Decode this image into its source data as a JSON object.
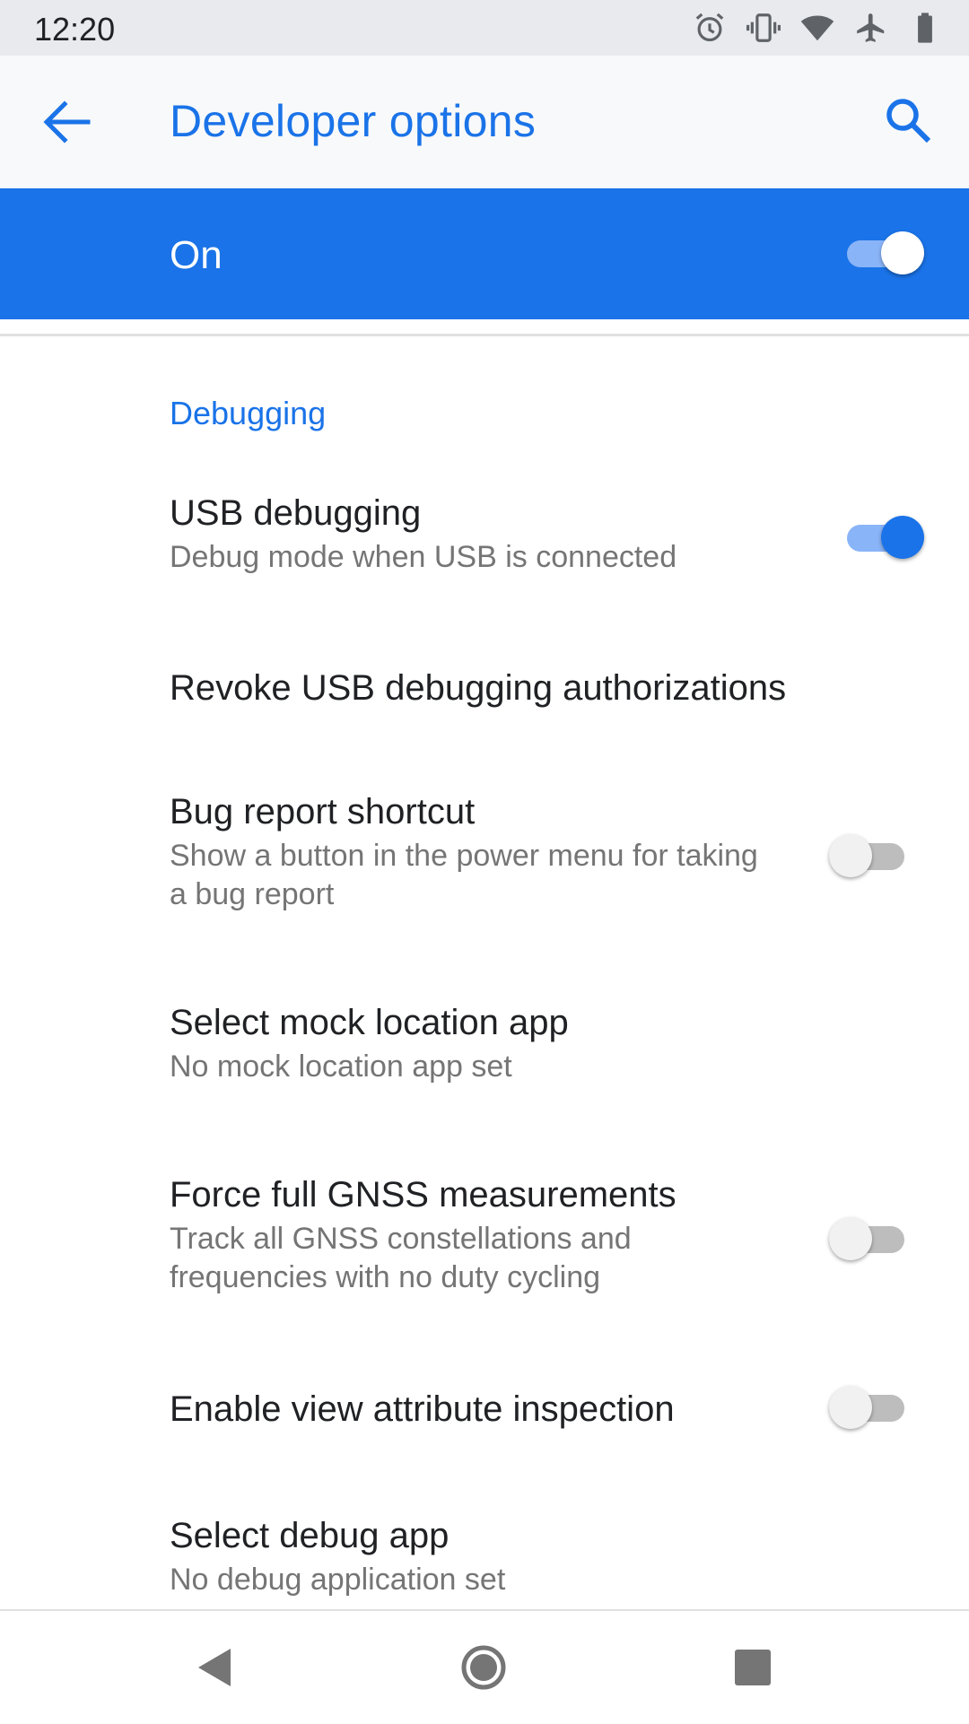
{
  "status_bar": {
    "time": "12:20",
    "icons": [
      "alarm-icon",
      "vibrate-icon",
      "wifi-icon",
      "airplane-icon",
      "battery-icon"
    ]
  },
  "app_bar": {
    "title": "Developer options",
    "back_icon": "arrow-back-icon",
    "search_icon": "search-icon"
  },
  "master_switch": {
    "label": "On",
    "checked": true
  },
  "section": {
    "title": "Debugging"
  },
  "preferences": [
    {
      "title": "USB debugging",
      "summary": "Debug mode when USB is connected",
      "switch": true,
      "checked": true
    },
    {
      "title": "Revoke USB debugging authorizations",
      "summary": "",
      "switch": false
    },
    {
      "title": "Bug report shortcut",
      "summary": "Show a button in the power menu for taking a bug report",
      "switch": true,
      "checked": false
    },
    {
      "title": "Select mock location app",
      "summary": "No mock location app set",
      "switch": false
    },
    {
      "title": "Force full GNSS measurements",
      "summary": "Track all GNSS constellations and frequencies with no duty cycling",
      "switch": true,
      "checked": false
    },
    {
      "title": "Enable view attribute inspection",
      "summary": "",
      "switch": true,
      "checked": false
    },
    {
      "title": "Select debug app",
      "summary": "No debug application set",
      "switch": false
    }
  ],
  "nav_bar": {
    "icons": [
      "nav-back-icon",
      "nav-home-icon",
      "nav-recents-icon"
    ]
  },
  "colors": {
    "accent": "#1a73e8",
    "switch_track_on": "#8ab4f8",
    "switch_track_off": "#bdbdbd",
    "text_primary": "#202124",
    "text_secondary": "#757575"
  }
}
